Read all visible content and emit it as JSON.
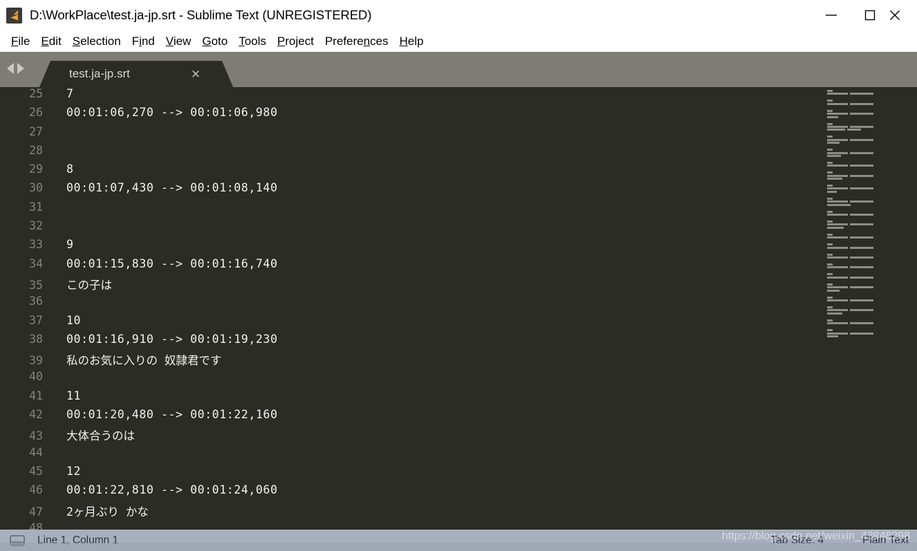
{
  "window": {
    "title": "D:\\WorkPlace\\test.ja-jp.srt - Sublime Text (UNREGISTERED)",
    "logo_icon": "sublime-text-logo-icon",
    "controls": {
      "minimize": "minimize-icon",
      "maximize": "maximize-icon",
      "close": "close-icon"
    }
  },
  "menubar": {
    "items": [
      {
        "pre": "",
        "mn": "F",
        "post": "ile"
      },
      {
        "pre": "",
        "mn": "E",
        "post": "dit"
      },
      {
        "pre": "",
        "mn": "S",
        "post": "election"
      },
      {
        "pre": "F",
        "mn": "i",
        "post": "nd"
      },
      {
        "pre": "",
        "mn": "V",
        "post": "iew"
      },
      {
        "pre": "",
        "mn": "G",
        "post": "oto"
      },
      {
        "pre": "",
        "mn": "T",
        "post": "ools"
      },
      {
        "pre": "",
        "mn": "P",
        "post": "roject"
      },
      {
        "pre": "Prefere",
        "mn": "n",
        "post": "ces"
      },
      {
        "pre": "",
        "mn": "H",
        "post": "elp"
      }
    ]
  },
  "tabbar": {
    "prev_icon": "arrow-left-icon",
    "next_icon": "arrow-right-icon",
    "tabs": [
      {
        "label": "test.ja-jp.srt",
        "close_icon": "close-tab-icon",
        "active": true
      }
    ]
  },
  "editor": {
    "first_line_number": 25,
    "lines": [
      {
        "n": "25",
        "text": "7",
        "cjk": false
      },
      {
        "n": "26",
        "text": "00:01:06,270 --> 00:01:06,980",
        "cjk": false
      },
      {
        "n": "27",
        "text": "",
        "cjk": false
      },
      {
        "n": "28",
        "text": "",
        "cjk": false
      },
      {
        "n": "29",
        "text": "8",
        "cjk": false
      },
      {
        "n": "30",
        "text": "00:01:07,430 --> 00:01:08,140",
        "cjk": false
      },
      {
        "n": "31",
        "text": "",
        "cjk": false
      },
      {
        "n": "32",
        "text": "",
        "cjk": false
      },
      {
        "n": "33",
        "text": "9",
        "cjk": false
      },
      {
        "n": "34",
        "text": "00:01:15,830 --> 00:01:16,740",
        "cjk": false
      },
      {
        "n": "35",
        "text": "この子は",
        "cjk": true
      },
      {
        "n": "36",
        "text": "",
        "cjk": false
      },
      {
        "n": "37",
        "text": "10",
        "cjk": false
      },
      {
        "n": "38",
        "text": "00:01:16,910 --> 00:01:19,230",
        "cjk": false
      },
      {
        "n": "39",
        "text": "私のお気に入りの 奴隷君です",
        "cjk": true
      },
      {
        "n": "40",
        "text": "",
        "cjk": false
      },
      {
        "n": "41",
        "text": "11",
        "cjk": false
      },
      {
        "n": "42",
        "text": "00:01:20,480 --> 00:01:22,160",
        "cjk": false
      },
      {
        "n": "43",
        "text": "大体合うのは",
        "cjk": true
      },
      {
        "n": "44",
        "text": "",
        "cjk": false
      },
      {
        "n": "45",
        "text": "12",
        "cjk": false
      },
      {
        "n": "46",
        "text": "00:01:22,810 --> 00:01:24,060",
        "cjk": false
      },
      {
        "n": "47",
        "text": "2ヶ月ぶり かな",
        "cjk": true
      },
      {
        "n": "48",
        "text": "",
        "cjk": false
      }
    ]
  },
  "minimap": {
    "blocks": [
      [
        [
          8
        ],
        [
          30,
          34
        ]
      ],
      [
        [
          8
        ],
        [
          30,
          34
        ]
      ],
      [
        [
          8
        ],
        [
          30,
          34
        ],
        [
          16
        ]
      ],
      [
        [
          8
        ],
        [
          30,
          34
        ],
        [
          26,
          20
        ]
      ],
      [
        [
          8
        ],
        [
          30,
          34
        ],
        [
          18
        ]
      ],
      [
        [
          8
        ],
        [
          30,
          34
        ],
        [
          20
        ]
      ],
      [
        [
          8
        ],
        [
          30,
          34
        ]
      ],
      [
        [
          8
        ],
        [
          30,
          34
        ],
        [
          22
        ]
      ],
      [
        [
          8
        ],
        [
          30,
          34
        ],
        [
          14
        ]
      ],
      [
        [
          8
        ],
        [
          30,
          34
        ],
        [
          34
        ]
      ],
      [
        [
          8
        ],
        [
          30,
          34
        ]
      ],
      [
        [
          8
        ],
        [
          30,
          34
        ],
        [
          24
        ]
      ],
      [
        [
          8
        ],
        [
          30,
          34
        ]
      ],
      [
        [
          8
        ],
        [
          30,
          34
        ]
      ],
      [
        [
          8
        ],
        [
          30,
          34
        ]
      ],
      [
        [
          8
        ],
        [
          30,
          34
        ]
      ],
      [
        [
          8
        ],
        [
          30,
          34
        ]
      ],
      [
        [
          8
        ],
        [
          30,
          34
        ],
        [
          18
        ]
      ],
      [
        [
          8
        ],
        [
          30,
          34
        ]
      ],
      [
        [
          8
        ],
        [
          30,
          34
        ],
        [
          22
        ]
      ],
      [
        [
          8
        ],
        [
          30,
          34
        ]
      ],
      [
        [
          8
        ],
        [
          30,
          34
        ],
        [
          16
        ]
      ]
    ]
  },
  "statusbar": {
    "panel_icon": "console-panel-icon",
    "cursor_position": "Line 1, Column 1",
    "tab_size": "Tab Size: 4",
    "syntax": "Plain Text"
  },
  "watermark": {
    "text": "https://blog.csdn.net/weixin_43948298"
  },
  "colors": {
    "titlebar_bg": "#ffffff",
    "tabbar_bg": "#7d7d75",
    "editor_bg": "#2b2c26",
    "gutter_fg": "#83847c",
    "code_fg": "#f3f3ec",
    "statusbar_bg": "#a9b0bd",
    "accent": "#f3a02a"
  }
}
